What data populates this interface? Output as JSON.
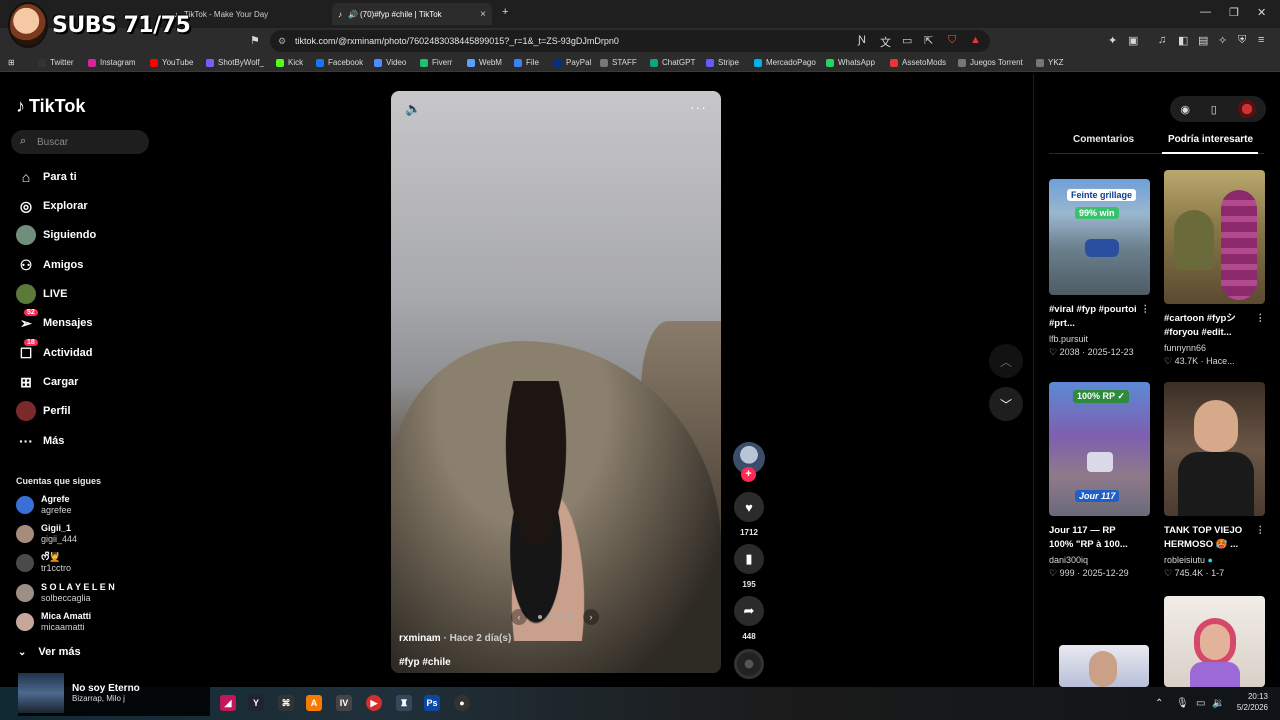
{
  "browser": {
    "tabs": [
      {
        "label": "TikTok - Make Your Day",
        "active": false
      },
      {
        "label": "(70)#fyp #chile | TikTok",
        "active": true
      }
    ],
    "url": "tiktok.com/@rxminam/photo/7602483038445899015?_r=1&_t=ZS-93gDJmDrpn0",
    "bookmarks": [
      "Twitter",
      "Instagram",
      "YouTube",
      "ShotByWolf_",
      "Kick",
      "Facebook",
      "Video",
      "Fiverr",
      "WebM",
      "File",
      "PayPal",
      "STAFF",
      "ChatGPT",
      "Stripe",
      "MercadoPago",
      "WhatsApp",
      "AssetoMods",
      "Juegos Torrent",
      "YKZ"
    ],
    "bookmark_colors": [
      "#333333",
      "#d6249f",
      "#ff0000",
      "#7b5cff",
      "#53fc18",
      "#1877f2",
      "#4d8bff",
      "#1dbf73",
      "#5aa0ff",
      "#3b82f6",
      "#003087",
      "#777777",
      "#10a37f",
      "#635bff",
      "#00b1ea",
      "#25d366",
      "#e53935",
      "#777777",
      "#777777"
    ]
  },
  "overlay": {
    "subs": "SUBS 71/75"
  },
  "sidebar": {
    "logo": "TikTok",
    "search_placeholder": "Buscar",
    "items": [
      {
        "label": "Para ti",
        "icon": "home-icon",
        "glyph": "⌂"
      },
      {
        "label": "Explorar",
        "icon": "compass-icon",
        "glyph": "◎"
      },
      {
        "label": "Siguiendo",
        "icon": "following-avatar-icon",
        "glyph": ""
      },
      {
        "label": "Amigos",
        "icon": "friends-icon",
        "glyph": "⚇"
      },
      {
        "label": "LIVE",
        "icon": "live-avatar-icon",
        "glyph": ""
      },
      {
        "label": "Mensajes",
        "icon": "messages-icon",
        "glyph": "➢",
        "badge": "52"
      },
      {
        "label": "Actividad",
        "icon": "activity-icon",
        "glyph": "☐",
        "badge": "18"
      },
      {
        "label": "Cargar",
        "icon": "upload-icon",
        "glyph": "⊞"
      },
      {
        "label": "Perfil",
        "icon": "profile-avatar-icon",
        "glyph": ""
      },
      {
        "label": "Más",
        "icon": "more-icon",
        "glyph": "···"
      }
    ],
    "following_title": "Cuentas que sigues",
    "accounts": [
      {
        "name": "Agrefe",
        "user": "agrefee",
        "color": "#3a6fd8"
      },
      {
        "name": "Gigii_1",
        "user": "gigii_444",
        "color": "#a78c7e"
      },
      {
        "name": "ᰔᩚ💆",
        "user": "tr1cctro",
        "color": "#4a4a4a"
      },
      {
        "name": "S O L A Y E L E N",
        "user": "solbeccaglia",
        "color": "#9c8f86"
      },
      {
        "name": "Mica Amatti",
        "user": "micaamatti",
        "color": "#c7a79a"
      }
    ],
    "ver_mas": "Ver más"
  },
  "video": {
    "author": "rxminam",
    "ago": " · Hace 2 día(s)",
    "tags": "#fyp #chile"
  },
  "actions": {
    "likes": "1712",
    "saves": "195",
    "shares": "448"
  },
  "right_panel": {
    "tab_comments": "Comentarios",
    "tab_interesting": "Podría interesarte",
    "cards": [
      {
        "title": "#viral #fyp #pourtoi #prt...",
        "user": "lfb.pursuit",
        "meta": "♡ 2038 · 2025-12-23",
        "thumb_label": "Feinte grillage",
        "thumb_sub": "99% win"
      },
      {
        "title": "#cartoon #fypシ #foryou #edit...",
        "user": "funnynn66",
        "meta": "♡ 43.7K · Hace..."
      },
      {
        "title": "Jour 117 — RP 100% \"RP à 100...",
        "user": "dani300iq",
        "meta": "♡ 999 · 2025-12-29",
        "thumb_label": "100% RP ✓",
        "thumb_sub": "Jour 117"
      },
      {
        "title": "TANK TOP VIEJO HERMOSO 🥵 ...",
        "user": "robleisiutu",
        "meta": "♡ 745.4K · 1-7"
      }
    ]
  },
  "mini_player": {
    "song": "No soy Eterno",
    "artist": "Bizarrap, Milo j"
  },
  "clock": {
    "time": "20:13",
    "date": "5/2/2026"
  }
}
